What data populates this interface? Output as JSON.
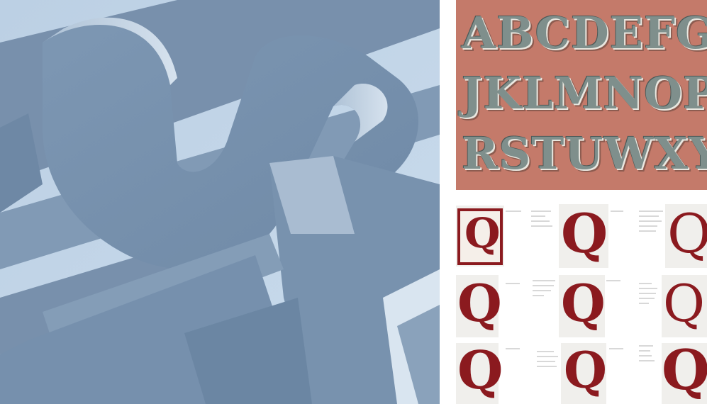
{
  "photos": {
    "sculpture": {
      "subject": "large pale blue 3D letter sculpture seen from below against sky"
    },
    "alphabet": {
      "subject": "decorative alphabet lettering on terracotta panel"
    },
    "sheets": {
      "subject": "sketch sheets of letter Q studies"
    }
  },
  "alphabet_rows": [
    "ABCDEFGH",
    "JKLMNOP",
    "RSTUWXY"
  ],
  "colors": {
    "sky": "#a9c1da",
    "sculpture_steel": "#7e98b4",
    "alphabet_background": "#c47a6a",
    "alphabet_letters": "#7f8f8c",
    "ink_maroon": "#8b1a1f"
  }
}
